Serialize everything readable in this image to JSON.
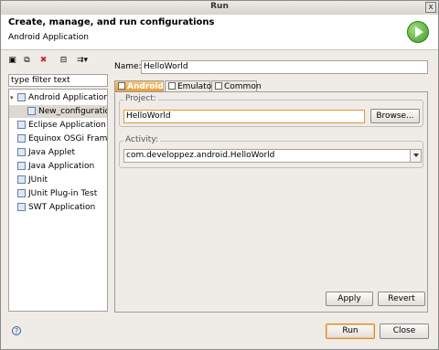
{
  "window": {
    "title": "Run",
    "close_glyph": "x"
  },
  "header": {
    "title": "Create, manage, and run configurations",
    "subtitle": "Android Application",
    "icon": "run-icon"
  },
  "toolbar": {
    "icons": [
      "new-config-icon",
      "duplicate-icon",
      "delete-icon",
      "collapse-all-icon",
      "filter-icon"
    ],
    "glyphs": [
      "▣",
      "⧉",
      "✖",
      "⊟",
      "⇉▾"
    ]
  },
  "filter": {
    "placeholder": "type filter text"
  },
  "tree": {
    "items": [
      {
        "label": "Android Application",
        "expanded": true,
        "expander": "▾"
      },
      {
        "label": "New_configuration",
        "selected": true
      },
      {
        "label": "Eclipse Application"
      },
      {
        "label": "Equinox OSGi Frame"
      },
      {
        "label": "Java Applet"
      },
      {
        "label": "Java Application"
      },
      {
        "label": "JUnit"
      },
      {
        "label": "JUnit Plug-in Test"
      },
      {
        "label": "SWT Application"
      }
    ]
  },
  "form": {
    "name_label": "Name:",
    "name_value": "HelloWorld",
    "tabs": [
      {
        "label": "Android",
        "active": true
      },
      {
        "label": "Emulator"
      },
      {
        "label": "Common"
      }
    ],
    "project_group": "Project:",
    "project_value": "HelloWorld",
    "browse_label": "Browse...",
    "activity_group": "Activity:",
    "activity_value": "com.developpez.android.HelloWorld",
    "apply_label": "Apply",
    "revert_label": "Revert"
  },
  "footer": {
    "help_glyph": "?",
    "run_label": "Run",
    "close_label": "Close"
  },
  "colors": {
    "accent": "#e49a36",
    "run_icon": "#3f9a2c"
  }
}
